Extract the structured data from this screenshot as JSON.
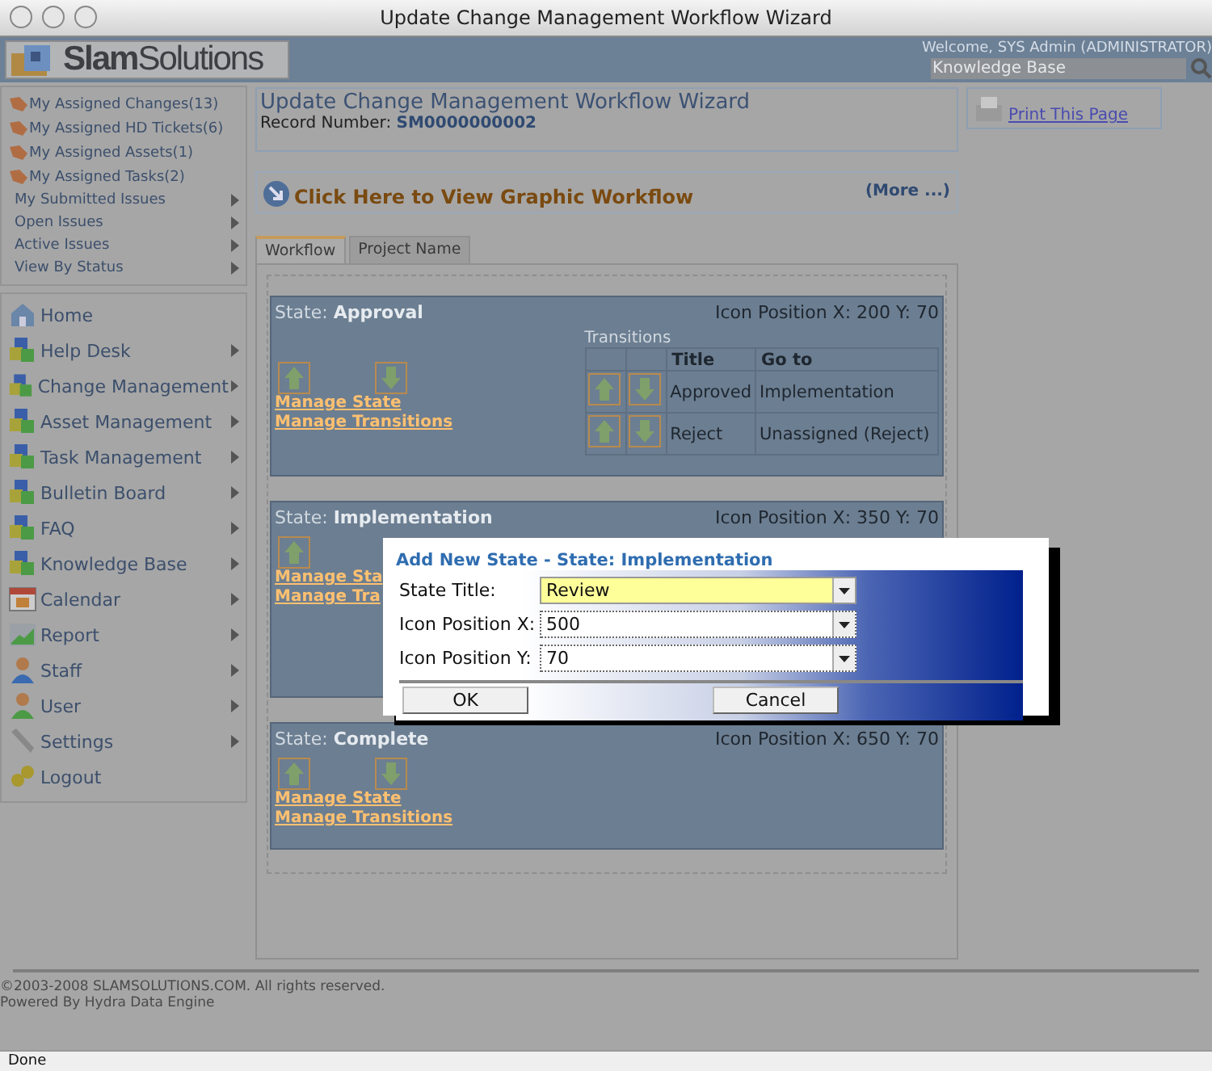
{
  "window": {
    "title": "Update Change Management Workflow Wizard"
  },
  "header": {
    "logo_bold": "Slam",
    "logo_light": "Solutions",
    "welcome": "Welcome, SYS Admin (ADMINISTRATOR)",
    "search": {
      "placeholder": "Knowledge Base"
    }
  },
  "sidebar": {
    "quick_links": [
      "My Assigned Changes(13)",
      "My Assigned HD Tickets(6)",
      "My Assigned Assets(1)",
      "My Assigned Tasks(2)"
    ],
    "issue_menus": [
      "My Submitted Issues",
      "Open Issues",
      "Active Issues",
      "View By Status"
    ],
    "nav": [
      {
        "label": "Home",
        "submenu": false
      },
      {
        "label": "Help Desk",
        "submenu": true
      },
      {
        "label": "Change Management",
        "submenu": true
      },
      {
        "label": "Asset Management",
        "submenu": true
      },
      {
        "label": "Task Management",
        "submenu": true
      },
      {
        "label": "Bulletin Board",
        "submenu": true
      },
      {
        "label": "FAQ",
        "submenu": true
      },
      {
        "label": "Knowledge Base",
        "submenu": true
      },
      {
        "label": "Calendar",
        "submenu": true
      },
      {
        "label": "Report",
        "submenu": true
      },
      {
        "label": "Staff",
        "submenu": true
      },
      {
        "label": "User",
        "submenu": true
      },
      {
        "label": "Settings",
        "submenu": true
      },
      {
        "label": "Logout",
        "submenu": false
      }
    ]
  },
  "page": {
    "title": "Update Change Management Workflow Wizard",
    "record_label": "Record Number:",
    "record_number": "SM0000000002"
  },
  "graphic_workflow": {
    "link": "Click Here to View Graphic Workflow",
    "more": "(More ...)"
  },
  "print": {
    "label": "Print This Page"
  },
  "tabs": [
    {
      "label": "Workflow",
      "selected": true
    },
    {
      "label": "Project Name",
      "selected": false
    }
  ],
  "states": [
    {
      "label": "State:",
      "name": "Approval",
      "position": "Icon Position X: 200 Y: 70",
      "move_down": true,
      "links": [
        "Manage State",
        "Manage Transitions"
      ],
      "transitions": {
        "heading": "Transitions",
        "columns": [
          "Title",
          "Go to"
        ],
        "rows": [
          {
            "title": "Approved",
            "goto": "Implementation"
          },
          {
            "title": "Reject",
            "goto": "Unassigned (Reject)"
          }
        ]
      }
    },
    {
      "label": "State:",
      "name": "Implementation",
      "position": "Icon Position X: 350 Y: 70",
      "move_down": false,
      "links": [
        "Manage Sta",
        "Manage Tra"
      ]
    },
    {
      "label": "State:",
      "name": "Complete",
      "position": "Icon Position X: 650 Y: 70",
      "move_down": true,
      "links": [
        "Manage State",
        "Manage Transitions"
      ]
    }
  ],
  "dialog": {
    "title": "Add New State - State: Implementation",
    "fields": [
      {
        "label": "State Title:",
        "value": "Review",
        "focused": true
      },
      {
        "label": "Icon Position X:",
        "value": "500",
        "focused": false
      },
      {
        "label": "Icon Position Y:",
        "value": "70",
        "focused": false
      }
    ],
    "buttons": [
      "OK",
      "Cancel"
    ]
  },
  "footer": {
    "copyright": "©2003-2008 SLAMSOLUTIONS.COM. All rights reserved.",
    "powered": "Powered By Hydra Data Engine"
  },
  "status_bar": {
    "text": "Done"
  }
}
